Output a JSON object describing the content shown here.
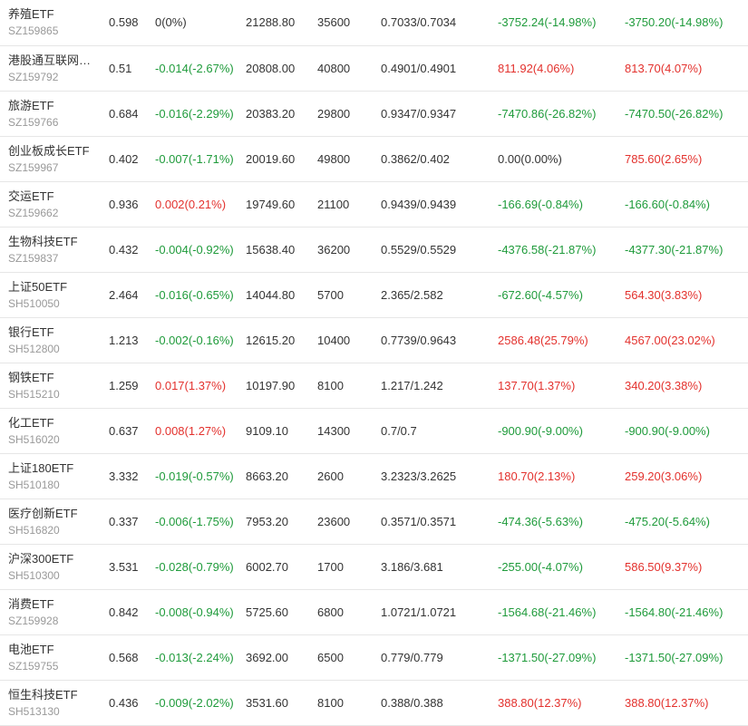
{
  "colors": {
    "up": "#e3312d",
    "down": "#1f9b3b",
    "flat": "#333333"
  },
  "rows": [
    {
      "name": "养殖ETF",
      "code": "SZ159865",
      "price": "0.598",
      "change": "0(0%)",
      "change_dir": "flat",
      "value": "21288.80",
      "qty": "35600",
      "cost": "0.7033/0.7034",
      "pl1": "-3752.24(-14.98%)",
      "pl1_dir": "down",
      "pl2": "-3750.20(-14.98%)",
      "pl2_dir": "down"
    },
    {
      "name": "港股通互联网…",
      "code": "SZ159792",
      "price": "0.51",
      "change": "-0.014(-2.67%)",
      "change_dir": "down",
      "value": "20808.00",
      "qty": "40800",
      "cost": "0.4901/0.4901",
      "pl1": "811.92(4.06%)",
      "pl1_dir": "up",
      "pl2": "813.70(4.07%)",
      "pl2_dir": "up"
    },
    {
      "name": "旅游ETF",
      "code": "SZ159766",
      "price": "0.684",
      "change": "-0.016(-2.29%)",
      "change_dir": "down",
      "value": "20383.20",
      "qty": "29800",
      "cost": "0.9347/0.9347",
      "pl1": "-7470.86(-26.82%)",
      "pl1_dir": "down",
      "pl2": "-7470.50(-26.82%)",
      "pl2_dir": "down"
    },
    {
      "name": "创业板成长ETF",
      "code": "SZ159967",
      "price": "0.402",
      "change": "-0.007(-1.71%)",
      "change_dir": "down",
      "value": "20019.60",
      "qty": "49800",
      "cost": "0.3862/0.402",
      "pl1": "0.00(0.00%)",
      "pl1_dir": "flat",
      "pl2": "785.60(2.65%)",
      "pl2_dir": "up"
    },
    {
      "name": "交运ETF",
      "code": "SZ159662",
      "price": "0.936",
      "change": "0.002(0.21%)",
      "change_dir": "up",
      "value": "19749.60",
      "qty": "21100",
      "cost": "0.9439/0.9439",
      "pl1": "-166.69(-0.84%)",
      "pl1_dir": "down",
      "pl2": "-166.60(-0.84%)",
      "pl2_dir": "down"
    },
    {
      "name": "生物科技ETF",
      "code": "SZ159837",
      "price": "0.432",
      "change": "-0.004(-0.92%)",
      "change_dir": "down",
      "value": "15638.40",
      "qty": "36200",
      "cost": "0.5529/0.5529",
      "pl1": "-4376.58(-21.87%)",
      "pl1_dir": "down",
      "pl2": "-4377.30(-21.87%)",
      "pl2_dir": "down"
    },
    {
      "name": "上证50ETF",
      "code": "SH510050",
      "price": "2.464",
      "change": "-0.016(-0.65%)",
      "change_dir": "down",
      "value": "14044.80",
      "qty": "5700",
      "cost": "2.365/2.582",
      "pl1": "-672.60(-4.57%)",
      "pl1_dir": "down",
      "pl2": "564.30(3.83%)",
      "pl2_dir": "up"
    },
    {
      "name": "银行ETF",
      "code": "SH512800",
      "price": "1.213",
      "change": "-0.002(-0.16%)",
      "change_dir": "down",
      "value": "12615.20",
      "qty": "10400",
      "cost": "0.7739/0.9643",
      "pl1": "2586.48(25.79%)",
      "pl1_dir": "up",
      "pl2": "4567.00(23.02%)",
      "pl2_dir": "up"
    },
    {
      "name": "钢铁ETF",
      "code": "SH515210",
      "price": "1.259",
      "change": "0.017(1.37%)",
      "change_dir": "up",
      "value": "10197.90",
      "qty": "8100",
      "cost": "1.217/1.242",
      "pl1": "137.70(1.37%)",
      "pl1_dir": "up",
      "pl2": "340.20(3.38%)",
      "pl2_dir": "up"
    },
    {
      "name": "化工ETF",
      "code": "SH516020",
      "price": "0.637",
      "change": "0.008(1.27%)",
      "change_dir": "up",
      "value": "9109.10",
      "qty": "14300",
      "cost": "0.7/0.7",
      "pl1": "-900.90(-9.00%)",
      "pl1_dir": "down",
      "pl2": "-900.90(-9.00%)",
      "pl2_dir": "down"
    },
    {
      "name": "上证180ETF",
      "code": "SH510180",
      "price": "3.332",
      "change": "-0.019(-0.57%)",
      "change_dir": "down",
      "value": "8663.20",
      "qty": "2600",
      "cost": "3.2323/3.2625",
      "pl1": "180.70(2.13%)",
      "pl1_dir": "up",
      "pl2": "259.20(3.06%)",
      "pl2_dir": "up"
    },
    {
      "name": "医疗创新ETF",
      "code": "SH516820",
      "price": "0.337",
      "change": "-0.006(-1.75%)",
      "change_dir": "down",
      "value": "7953.20",
      "qty": "23600",
      "cost": "0.3571/0.3571",
      "pl1": "-474.36(-5.63%)",
      "pl1_dir": "down",
      "pl2": "-475.20(-5.64%)",
      "pl2_dir": "down"
    },
    {
      "name": "沪深300ETF",
      "code": "SH510300",
      "price": "3.531",
      "change": "-0.028(-0.79%)",
      "change_dir": "down",
      "value": "6002.70",
      "qty": "1700",
      "cost": "3.186/3.681",
      "pl1": "-255.00(-4.07%)",
      "pl1_dir": "down",
      "pl2": "586.50(9.37%)",
      "pl2_dir": "up"
    },
    {
      "name": "消费ETF",
      "code": "SZ159928",
      "price": "0.842",
      "change": "-0.008(-0.94%)",
      "change_dir": "down",
      "value": "5725.60",
      "qty": "6800",
      "cost": "1.0721/1.0721",
      "pl1": "-1564.68(-21.46%)",
      "pl1_dir": "down",
      "pl2": "-1564.80(-21.46%)",
      "pl2_dir": "down"
    },
    {
      "name": "电池ETF",
      "code": "SZ159755",
      "price": "0.568",
      "change": "-0.013(-2.24%)",
      "change_dir": "down",
      "value": "3692.00",
      "qty": "6500",
      "cost": "0.779/0.779",
      "pl1": "-1371.50(-27.09%)",
      "pl1_dir": "down",
      "pl2": "-1371.50(-27.09%)",
      "pl2_dir": "down"
    },
    {
      "name": "恒生科技ETF",
      "code": "SH513130",
      "price": "0.436",
      "change": "-0.009(-2.02%)",
      "change_dir": "down",
      "value": "3531.60",
      "qty": "8100",
      "cost": "0.388/0.388",
      "pl1": "388.80(12.37%)",
      "pl1_dir": "up",
      "pl2": "388.80(12.37%)",
      "pl2_dir": "up"
    }
  ]
}
